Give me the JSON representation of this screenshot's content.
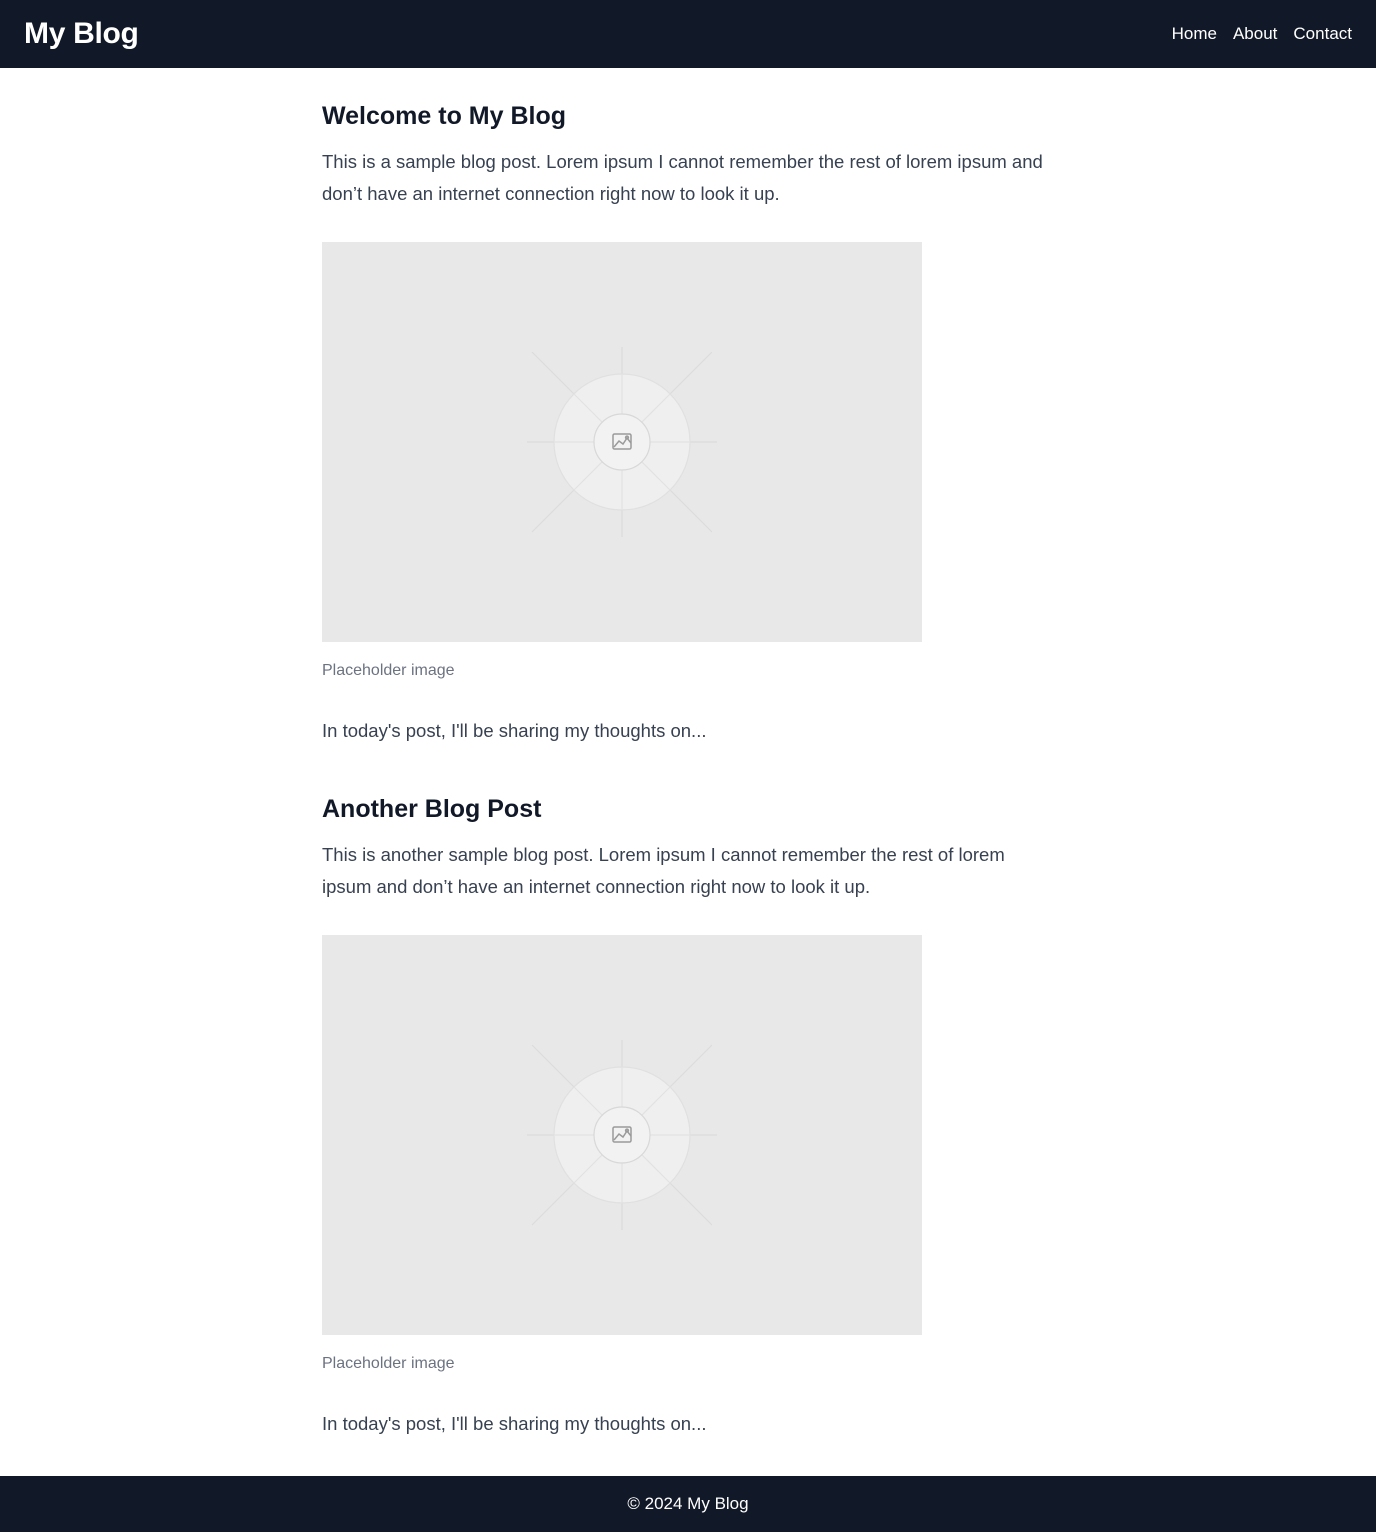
{
  "header": {
    "brand": "My Blog",
    "nav": [
      "Home",
      "About",
      "Contact"
    ]
  },
  "posts": [
    {
      "title": "Welcome to My Blog",
      "body": "This is a sample blog post. Lorem ipsum I cannot remember the rest of lorem ipsum and don’t have an internet connection right now to look it up.",
      "image_icon": "image-placeholder-icon",
      "caption": "Placeholder image",
      "outro": "In today's post, I'll be sharing my thoughts on..."
    },
    {
      "title": "Another Blog Post",
      "body": "This is another sample blog post. Lorem ipsum I cannot remember the rest of lorem ipsum and don’t have an internet connection right now to look it up.",
      "image_icon": "image-placeholder-icon",
      "caption": "Placeholder image",
      "outro": "In today's post, I'll be sharing my thoughts on..."
    }
  ],
  "footer": {
    "text": "© 2024 My Blog"
  },
  "colors": {
    "header_bg": "#111827",
    "footer_bg": "#111827",
    "placeholder_bg": "#e8e8e8",
    "text": "#374151",
    "heading": "#111827",
    "caption": "#6b7280"
  }
}
